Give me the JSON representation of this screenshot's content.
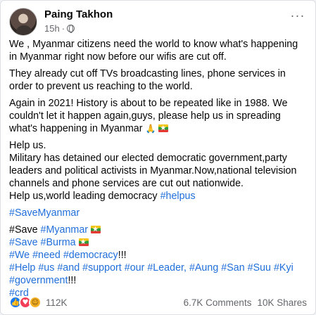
{
  "post": {
    "author": "Paing Takhon",
    "time": "15h",
    "dot": "·",
    "more_menu": "···"
  },
  "content": {
    "p1": "We , Myanmar citizens need  the world to know what's happening in Myanmar right now   before our wifis are cut off.",
    "p2": "They already cut off TVs broadcasting lines, phone services in order to prevent us reaching  to the world.",
    "p3": "Again in 2021! History is about to be repeated like in 1988. We couldn't let it happen again,guys, please help us in spreading what's happening in Myanmar",
    "p4_line1": "Help us.",
    "p4_line2": "Military has detained our elected democratic government,party leaders and political activists in Myanmar.Now,national television channels and phone services are cut out nationwide.",
    "p4_line3": "Help us,world leading democracy ",
    "tag_helpus": "#helpus",
    "tag_savemyanmar": "#SaveMyanmar",
    "save_myanmar_prefix": "#Save ",
    "tag_myanmar": "#Myanmar",
    "tag_save_burma": "#Save #Burma",
    "tag_we_need_democracy": "#We #need #democracy",
    "exclaim": "!!!",
    "tag_help_line": "#Help #us #and #support #our #Leader,  #Aung #San #Suu #Kyi",
    "tag_government": "#government",
    "tag_crd": "#crd"
  },
  "footer": {
    "reaction_count": "112K",
    "comments": "6.7K Comments",
    "shares": "10K Shares"
  },
  "icons": {
    "reactions": [
      "like-icon",
      "love-icon",
      "haha-icon"
    ],
    "flag": "myanmar-flag-icon",
    "praying_hands": "praying-hands-icon"
  },
  "colors": {
    "hashtag": "#216fdb",
    "muted": "#65676b",
    "like": "#1877f2",
    "love": "#f33e58"
  }
}
